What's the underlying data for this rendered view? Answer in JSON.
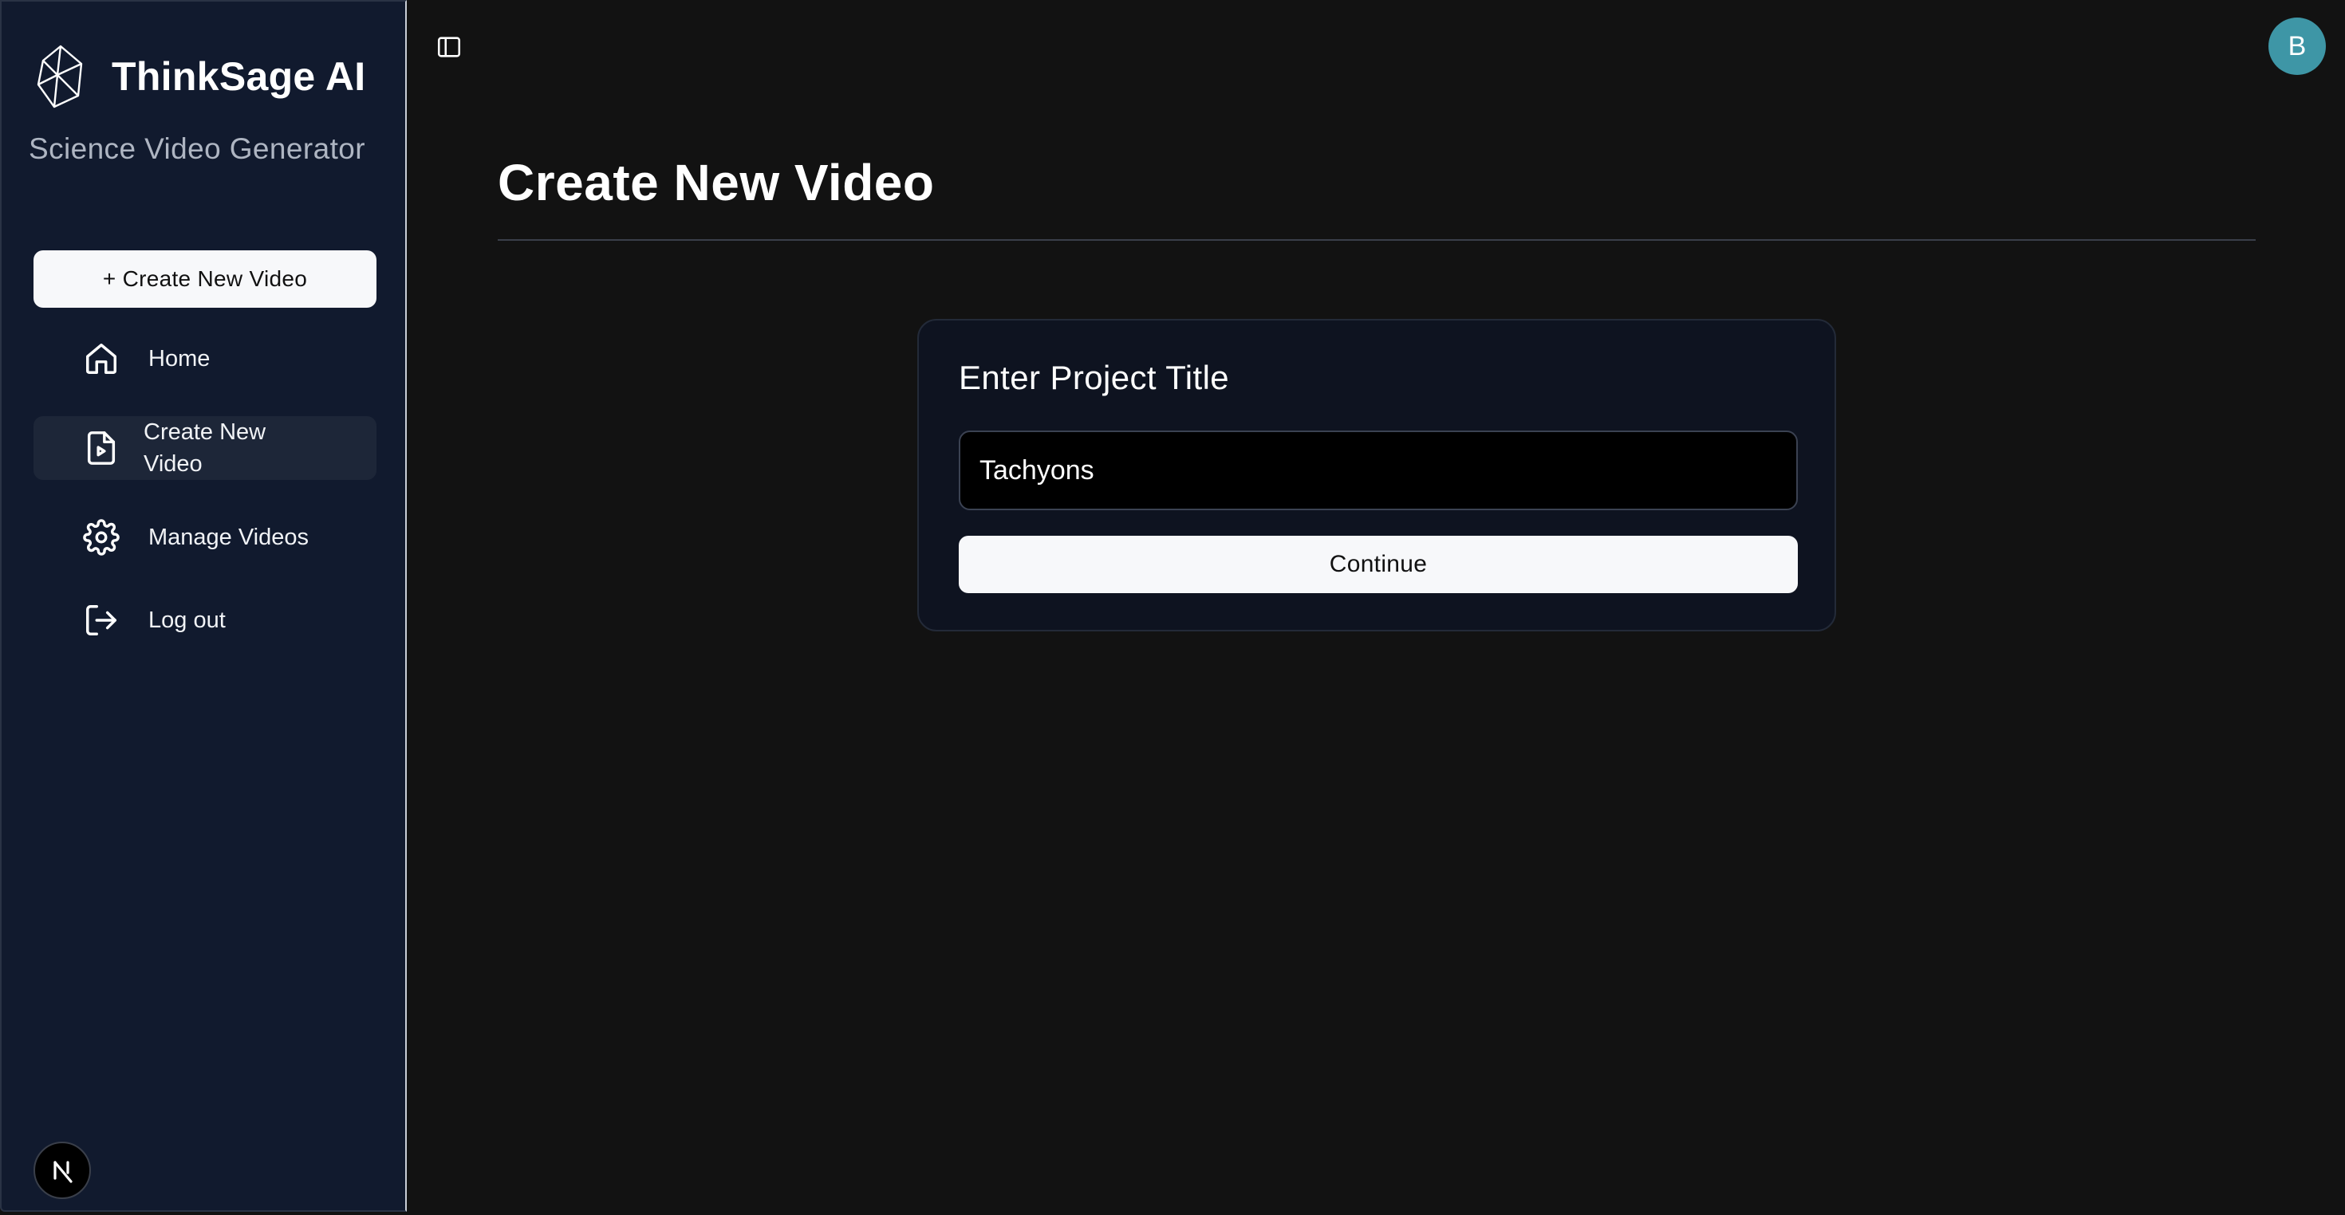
{
  "sidebar": {
    "brand_name": "ThinkSage AI",
    "brand_subtitle": "Science Video Generator",
    "create_button_label": "+ Create New Video",
    "items": [
      {
        "label": "Home",
        "icon": "home-icon"
      },
      {
        "label": "Create New Video",
        "icon": "video-file-icon",
        "active": true
      },
      {
        "label": "Manage Videos",
        "icon": "gear-icon"
      },
      {
        "label": "Log out",
        "icon": "logout-icon"
      }
    ],
    "footer_badge": "N"
  },
  "header": {
    "avatar_initial": "B",
    "avatar_color": "#3e96a6"
  },
  "main": {
    "page_title": "Create New Video",
    "card": {
      "title": "Enter Project Title",
      "input_value": "Tachyons",
      "continue_label": "Continue"
    }
  },
  "colors": {
    "sidebar_bg": "#111a2e",
    "main_bg": "#121212",
    "card_bg": "#0e1320",
    "button_bg": "#f7f8fa"
  }
}
